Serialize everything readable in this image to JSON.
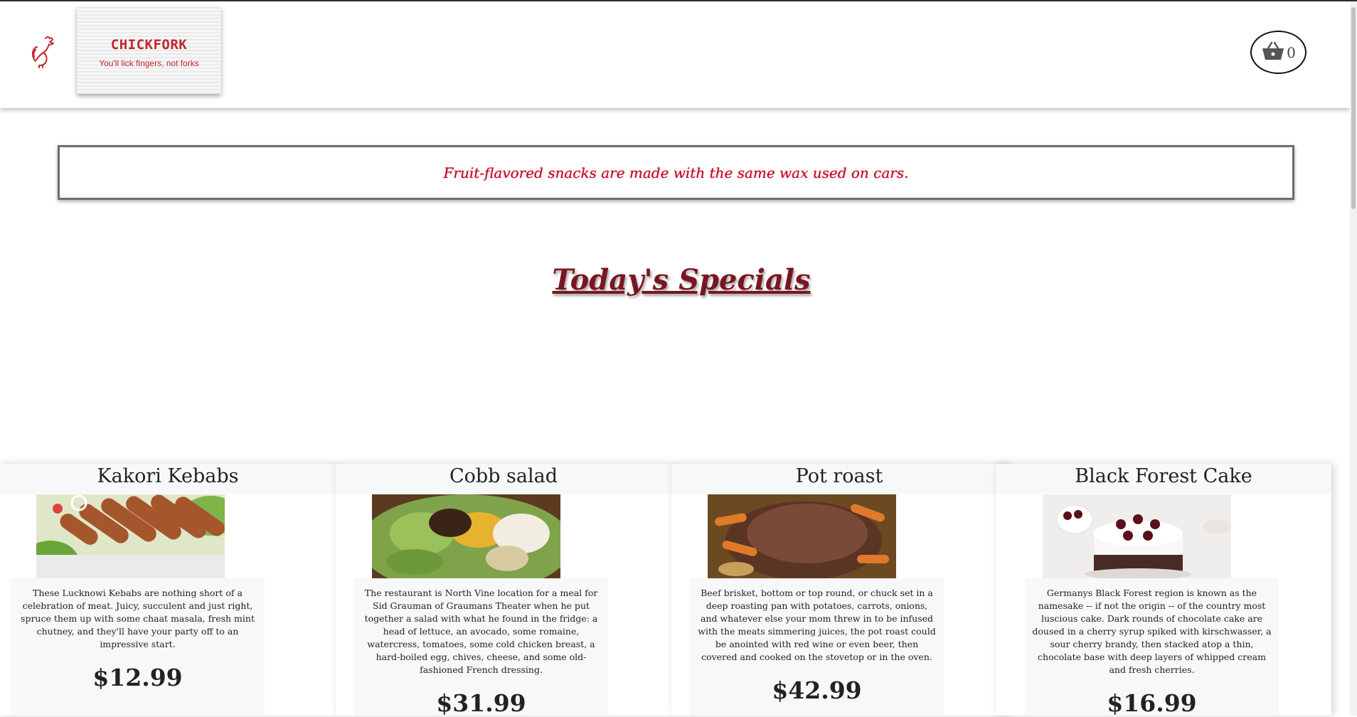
{
  "header": {
    "logo_title": "CHICKFORK",
    "logo_tagline": "You'll lick fingers, not forks",
    "cart_count": "0"
  },
  "fact": {
    "text": "Fruit-flavored snacks are made with the same wax used on cars."
  },
  "specials": {
    "title": "Today's Specials",
    "items": [
      {
        "name": "Kakori Kebabs",
        "description": "These Lucknowi Kebabs are nothing short of a celebration of meat. Juicy, succulent and just right, spruce them up with some chaat masala, fresh mint chutney, and they'll have your party off to an impressive start.",
        "price": "$12.99"
      },
      {
        "name": "Cobb salad",
        "description": "The restaurant is North Vine location for a meal for Sid Grauman of Graumans Theater when he put together a salad with what he found in the fridge: a head of lettuce, an avocado, some romaine, watercress, tomatoes, some cold chicken breast, a hard-boiled egg, chives, cheese, and some old-fashioned French dressing.",
        "price": "$31.99"
      },
      {
        "name": "Pot roast",
        "description": "Beef brisket, bottom or top round, or chuck set in a deep roasting pan with potatoes, carrots, onions, and whatever else your mom threw in to be infused with the meats simmering juices, the pot roast could be anointed with red wine or even beer, then covered and cooked on the stovetop or in the oven.",
        "price": "$42.99"
      },
      {
        "name": "Black Forest Cake",
        "description": "Germanys Black Forest region is known as the namesake -- if not the origin -- of the country most luscious cake. Dark rounds of chocolate cake are doused in a cherry syrup spiked with kirschwasser, a sour cherry brandy, then stacked atop a thin, chocolate base with deep layers of whipped cream and fresh cherries.",
        "price": "$16.99"
      }
    ]
  },
  "colors": {
    "brand_red": "#c1272d",
    "fact_red": "#c1001f",
    "title_maroon": "#7a1620"
  },
  "icons": [
    "rooster-logo-icon",
    "shopping-basket-icon"
  ]
}
